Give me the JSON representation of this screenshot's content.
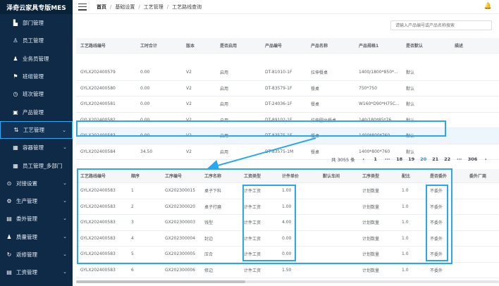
{
  "app": {
    "title": "泽奇云家具专版MES"
  },
  "sidebar": {
    "items": [
      {
        "label": "部门管理",
        "icon": "building-icon"
      },
      {
        "label": "员工管理",
        "icon": "user-icon"
      },
      {
        "label": "业务员管理",
        "icon": "person-icon"
      },
      {
        "label": "班组管理",
        "icon": "flag-icon"
      },
      {
        "label": "班次管理",
        "icon": "clock-icon"
      },
      {
        "label": "产品管理",
        "icon": "box-icon"
      },
      {
        "label": "工艺管理",
        "icon": "flow-icon"
      },
      {
        "label": "容器管理",
        "icon": "grid-icon"
      },
      {
        "label": "员工管理_多部门",
        "icon": "grid-icon"
      },
      {
        "label": "对接设置",
        "icon": "link-icon"
      },
      {
        "label": "生产管理",
        "icon": "gear-icon"
      },
      {
        "label": "委外管理",
        "icon": "doc-icon"
      },
      {
        "label": "质量管理",
        "icon": "person-icon"
      },
      {
        "label": "返修管理",
        "icon": "refresh-icon"
      },
      {
        "label": "工资管理",
        "icon": "doc-icon"
      }
    ]
  },
  "topbar": {
    "breadcrumb": [
      "首页",
      "基础设置",
      "工艺管理",
      "工艺路线查询"
    ]
  },
  "search": {
    "placeholder": "请输入产品编号或产品名称搜索"
  },
  "table1": {
    "columns": [
      "工艺路线编号",
      "工时合计",
      "版本",
      "是否启用",
      "产品编号",
      "产品名称",
      "产品规格1",
      "是否默认",
      "描述"
    ],
    "rows": [
      [
        "GYLX202400579",
        "0.00",
        "V2",
        "启用",
        "DT-81010-1F",
        "拉伸餐桌",
        "1400/1800*850*...",
        "默认",
        ""
      ],
      [
        "GYLX202400580",
        "0.00",
        "V2",
        "启用",
        "DT-83579-1F",
        "餐桌",
        "750*750",
        "默认",
        ""
      ],
      [
        "GYLX202400581",
        "0.00",
        "V2",
        "启用",
        "DT-24036-1F",
        "餐桌",
        "W160*D90*H75C...",
        "默认",
        ""
      ],
      [
        "GYLX202400582",
        "0.00",
        "V2",
        "启用",
        "DT-89102-1F",
        "拉伸圆台餐桌",
        "140/180*85*76",
        "默认",
        ""
      ],
      [
        "GYLX202400583",
        "0.00",
        "V2",
        "启用",
        "DT-83575-1F",
        "餐桌",
        "1400*800*760",
        "默认",
        ""
      ],
      [
        "GYLX202400584",
        "34.50",
        "V2",
        "启用",
        "DT-83575-1M",
        "餐桌",
        "1400*800*760",
        "默认",
        ""
      ]
    ]
  },
  "pager": {
    "total": "共 3055 条",
    "prev": "‹",
    "pages": [
      "1",
      "···",
      "18",
      "19",
      "20",
      "21",
      "22",
      "···",
      "306"
    ],
    "active": "20",
    "next": "›"
  },
  "table2": {
    "columns": [
      "工艺路线编号",
      "顺序",
      "工序编号",
      "工序名称",
      "工资类型",
      "计件单价",
      "默认车间",
      "工序类型",
      "配比",
      "是否委外",
      "委外厂商"
    ],
    "rows": [
      [
        "GYLX202400583",
        "1",
        "GX202300015",
        "桌子下料",
        "计件工资",
        "1.00",
        "",
        "计划数量",
        "1.0",
        "不委外",
        ""
      ],
      [
        "GYLX202400583",
        "2",
        "GX202300020",
        "桌子打磨",
        "计件工资",
        "1.00",
        "",
        "计划数量",
        "1.0",
        "不委外",
        ""
      ],
      [
        "GYLX202400583",
        "3",
        "GX202300003",
        "钱型",
        "计件工资",
        "4.00",
        "",
        "计划数量",
        "1.0",
        "不委外",
        ""
      ],
      [
        "GYLX202400583",
        "4",
        "GX202300004",
        "封边",
        "计件工资",
        "0.00",
        "",
        "计划数量",
        "1.0",
        "不委外",
        ""
      ],
      [
        "GYLX202400583",
        "5",
        "GX202300005",
        "压合",
        "计件工资",
        "0.00",
        "",
        "计划数量",
        "1.0",
        "不委外",
        ""
      ],
      [
        "GYLX202400583",
        "6",
        "GX202300006",
        "修边",
        "计件工资",
        "1.50",
        "",
        "计划数量",
        "1.0",
        "不委外",
        ""
      ]
    ]
  },
  "colors": {
    "sidebar_bg": "#0e2a46",
    "highlight": "#2aa8ef",
    "active_page": "#1e88e5"
  }
}
